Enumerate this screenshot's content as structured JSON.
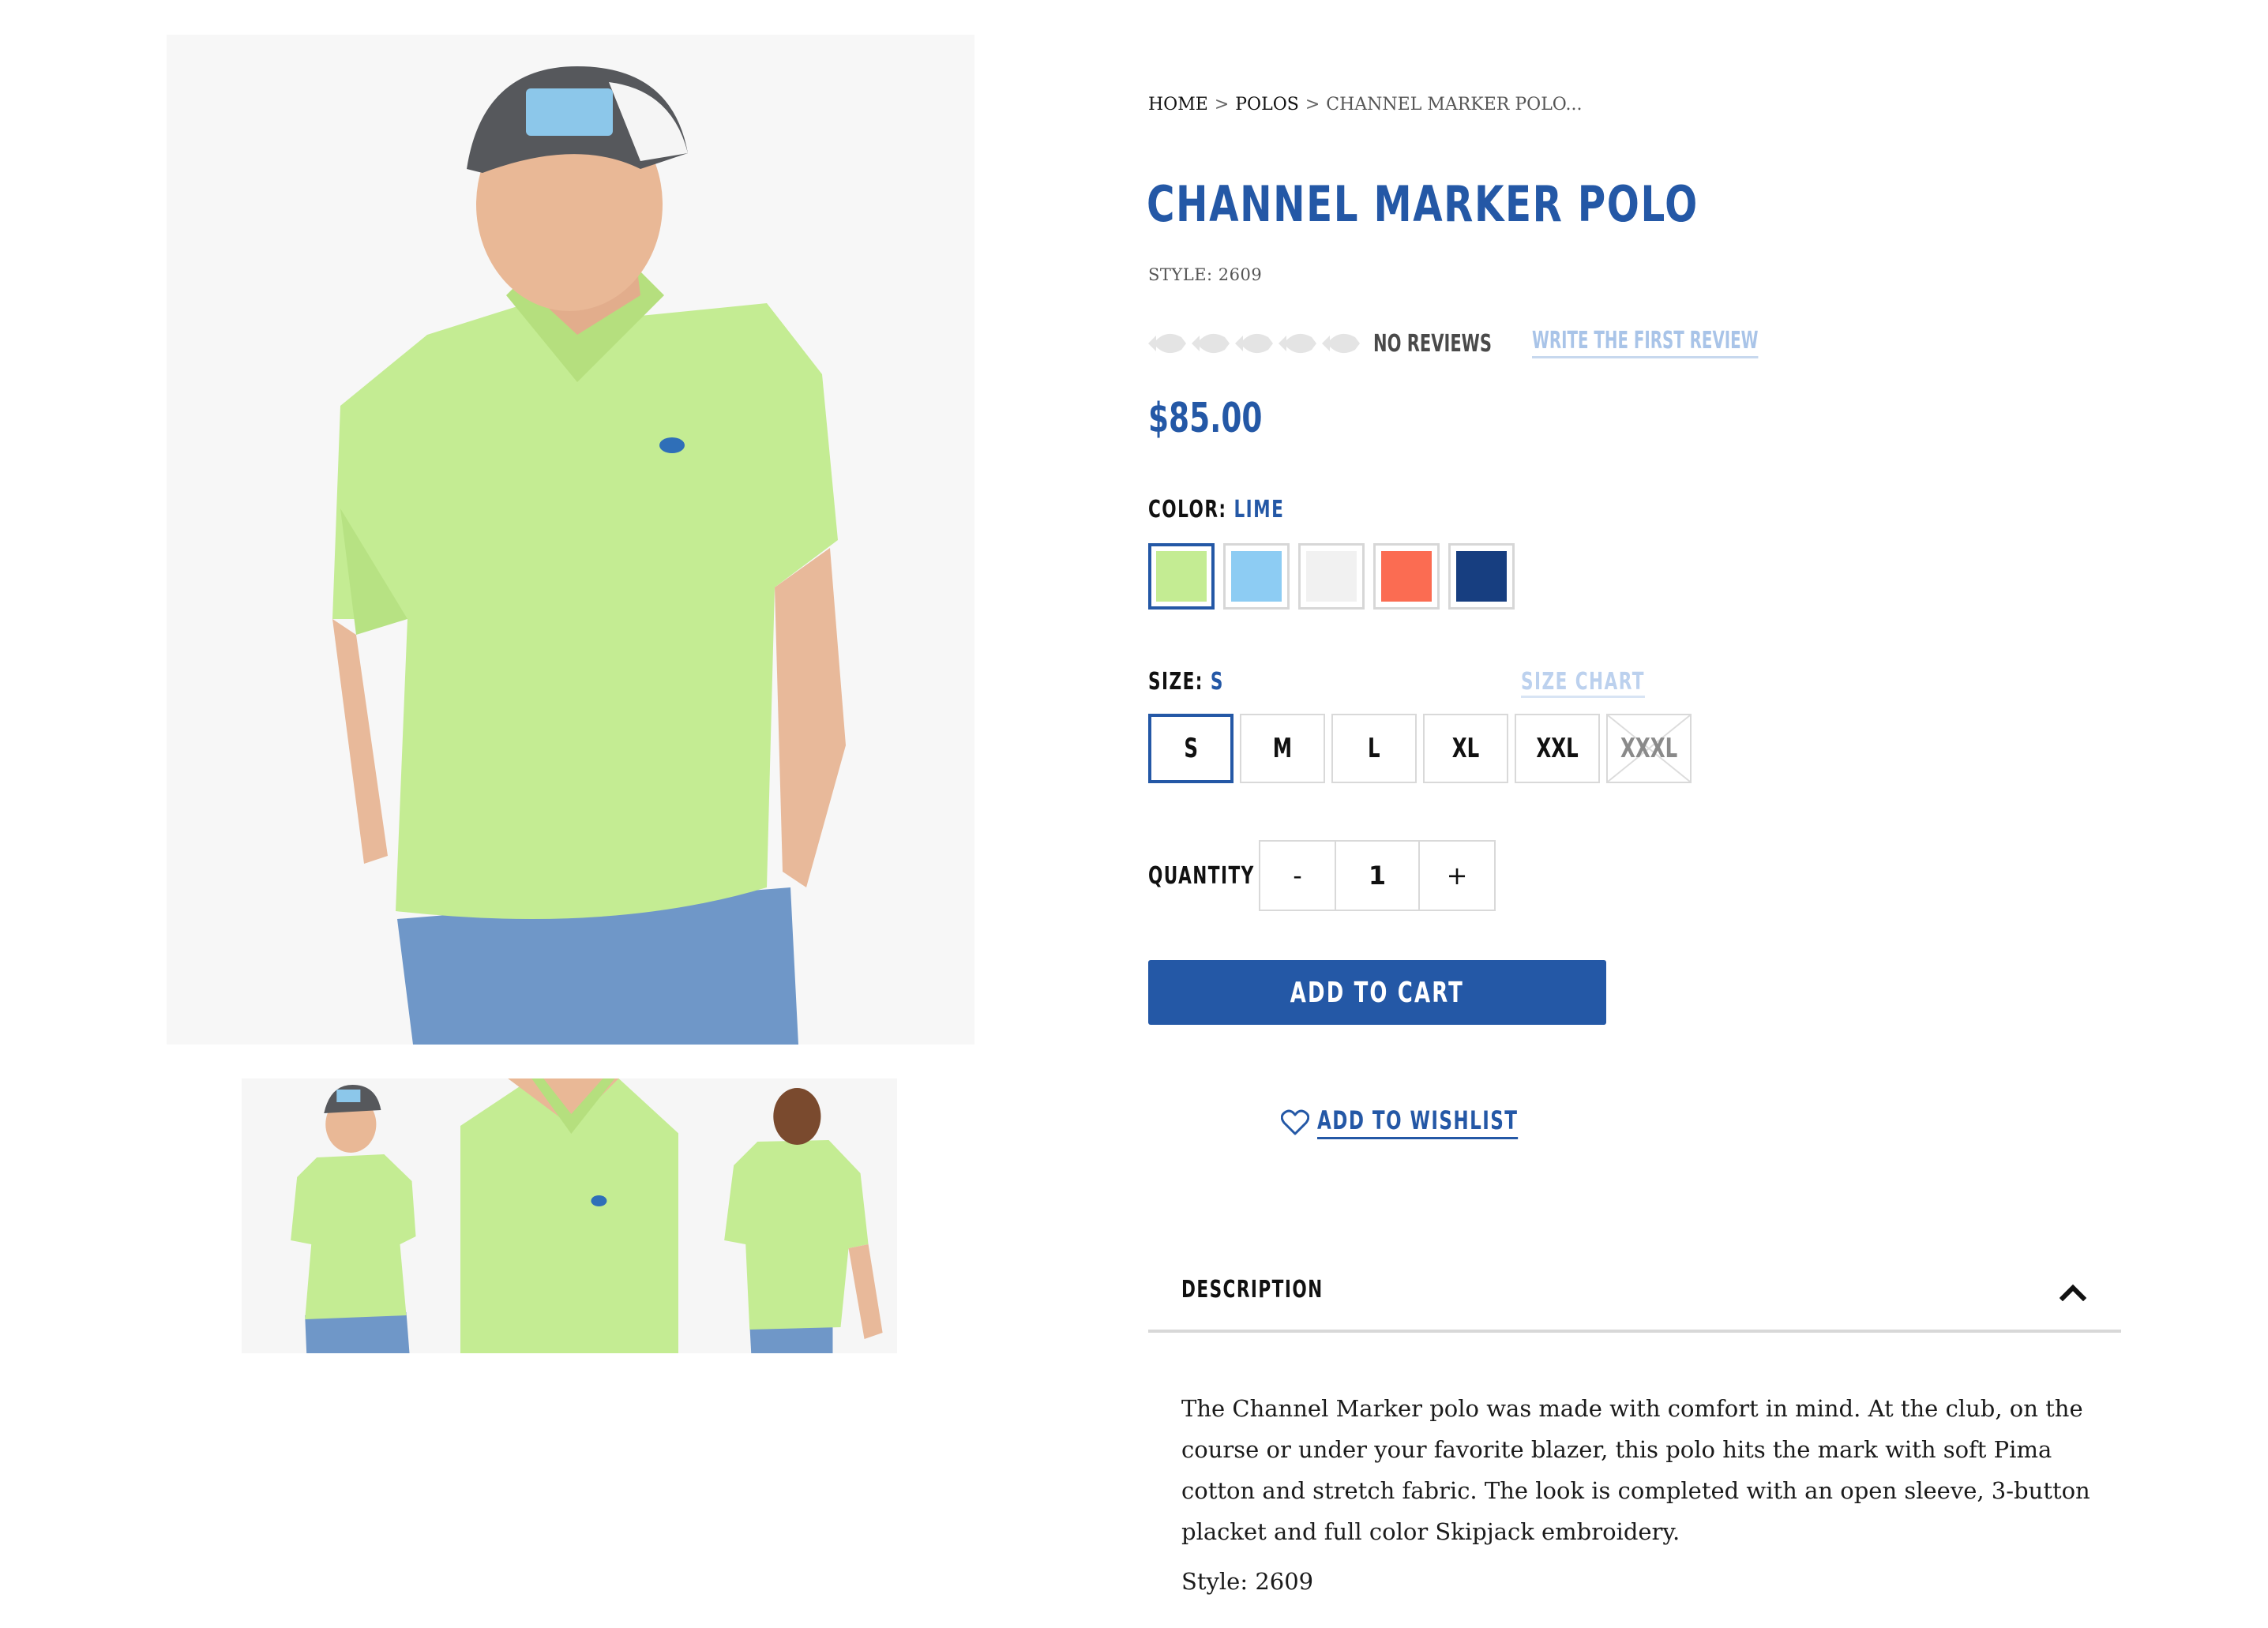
{
  "breadcrumb": {
    "items": [
      {
        "label": "HOME"
      },
      {
        "label": "POLOS"
      },
      {
        "label": "CHANNEL MARKER POLO..."
      }
    ],
    "separator": ">"
  },
  "product": {
    "title": "CHANNEL MARKER POLO",
    "style_line": "STYLE: 2609",
    "rating": {
      "stars_filled": 0,
      "stars_total": 5,
      "icon": "fish-icon",
      "no_reviews": "NO REVIEWS",
      "write_review": "WRITE THE FIRST REVIEW"
    },
    "price": "$85.00"
  },
  "color": {
    "label": "COLOR:",
    "selected": "LIME",
    "swatches": [
      {
        "name": "lime",
        "hex": "#c4ec93",
        "selected": true
      },
      {
        "name": "light-blue",
        "hex": "#8dccf3",
        "selected": false
      },
      {
        "name": "white",
        "hex": "#f1f1f1",
        "selected": false
      },
      {
        "name": "coral",
        "hex": "#fb6c52",
        "selected": false
      },
      {
        "name": "navy",
        "hex": "#173e80",
        "selected": false
      }
    ]
  },
  "size": {
    "label": "SIZE:",
    "selected": "S",
    "chart_link": "SIZE CHART",
    "options": [
      {
        "label": "S",
        "selected": true,
        "available": true
      },
      {
        "label": "M",
        "selected": false,
        "available": true
      },
      {
        "label": "L",
        "selected": false,
        "available": true
      },
      {
        "label": "XL",
        "selected": false,
        "available": true
      },
      {
        "label": "XXL",
        "selected": false,
        "available": true
      },
      {
        "label": "XXXL",
        "selected": false,
        "available": false
      }
    ]
  },
  "quantity": {
    "label": "QUANTITY",
    "minus": "-",
    "value": "1",
    "plus": "+"
  },
  "actions": {
    "add_to_cart": "ADD TO CART",
    "add_to_wishlist": "ADD TO WISHLIST"
  },
  "description": {
    "heading": "DESCRIPTION",
    "text": "The Channel Marker polo was made with comfort in mind. At the club, on the course or under your favorite blazer, this polo hits the mark with soft Pima cotton and stretch fabric. The look is completed with an open sleeve, 3-button placket and full color Skipjack embroidery.",
    "style": "Style: 2609"
  },
  "colors": {
    "brand_blue": "#2458a6",
    "link_light": "#a9c4e8",
    "shirt": "#c4ec93",
    "shorts": "#6f97c8"
  }
}
